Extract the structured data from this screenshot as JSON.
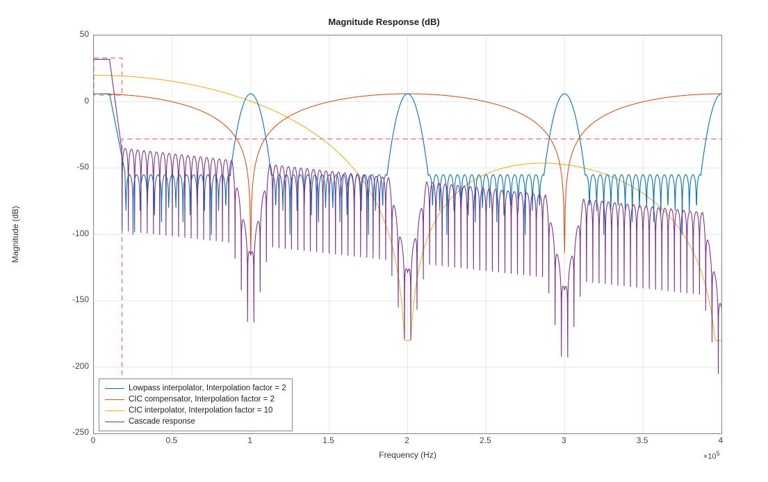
{
  "chart_data": {
    "type": "line",
    "title": "Magnitude Response (dB)",
    "xlabel": "Frequency (Hz)",
    "ylabel": "Magnitude (dB)",
    "x_exponent": "×10",
    "x_exponent_sup": "5",
    "xticks": [
      0,
      0.5,
      1,
      1.5,
      2,
      2.5,
      3,
      3.5,
      4
    ],
    "yticks": [
      -250,
      -200,
      -150,
      -100,
      -50,
      0,
      50
    ],
    "xlim": [
      0,
      4
    ],
    "ylim": [
      -250,
      50
    ],
    "colors": {
      "lowpass": "#0072BD",
      "cic_comp": "#D95319",
      "cic_interp": "#EDB120",
      "cascade": "#7E2F8E",
      "mask": "#FF6666"
    },
    "series": [
      {
        "name": "Lowpass interpolator, Interpolation factor = 2",
        "color": "#0072BD",
        "description": "Passband ~6 dB 0-0.1e5, nulls to ~-95 dB, periodic lobes across band peaking ~6 dB at multiples of 1e5, sidelobe envelope ~-55 dB"
      },
      {
        "name": "CIC compensator, Interpolation factor = 2",
        "color": "#D95319",
        "description": "Gain ~6 dB near DC, nulls around 1e5 and 3e5 down to ~-100 dB, smooth arcs peaking ~6 dB at 2e5 and 4e5"
      },
      {
        "name": "CIC interpolator, Interpolation factor = 10",
        "color": "#EDB120",
        "description": "~20 dB at DC, gradual droop, deep null ~-180 dB at 2e5, secondary lobe peaking ~-20 dB at 2.8e5, null near 4e5"
      },
      {
        "name": "Cascade response",
        "color": "#7E2F8E",
        "description": "Passband ~32 dB 0-0.1e5, steep roll-off, very ripply stopband decaying from about -40 dB down past -150 dB, deep notches around 2e5 and 4e5"
      },
      {
        "name": "Design mask",
        "color": "#FF6666",
        "style": "dashed",
        "mask": {
          "pass_low_x": 0,
          "pass_high_x": 0.18,
          "pass_top_db": 33,
          "pass_bot_db": 5,
          "stop_start_x": 0.18,
          "stop_vert_bottom_db": -225,
          "stop_level_db": -28,
          "stop_end_x": 4
        }
      }
    ],
    "legend": {
      "items": [
        "Lowpass interpolator, Interpolation factor = 2",
        "CIC compensator, Interpolation factor = 2",
        "CIC interpolator, Interpolation factor = 10",
        "Cascade response"
      ],
      "position": "lower-left"
    }
  }
}
